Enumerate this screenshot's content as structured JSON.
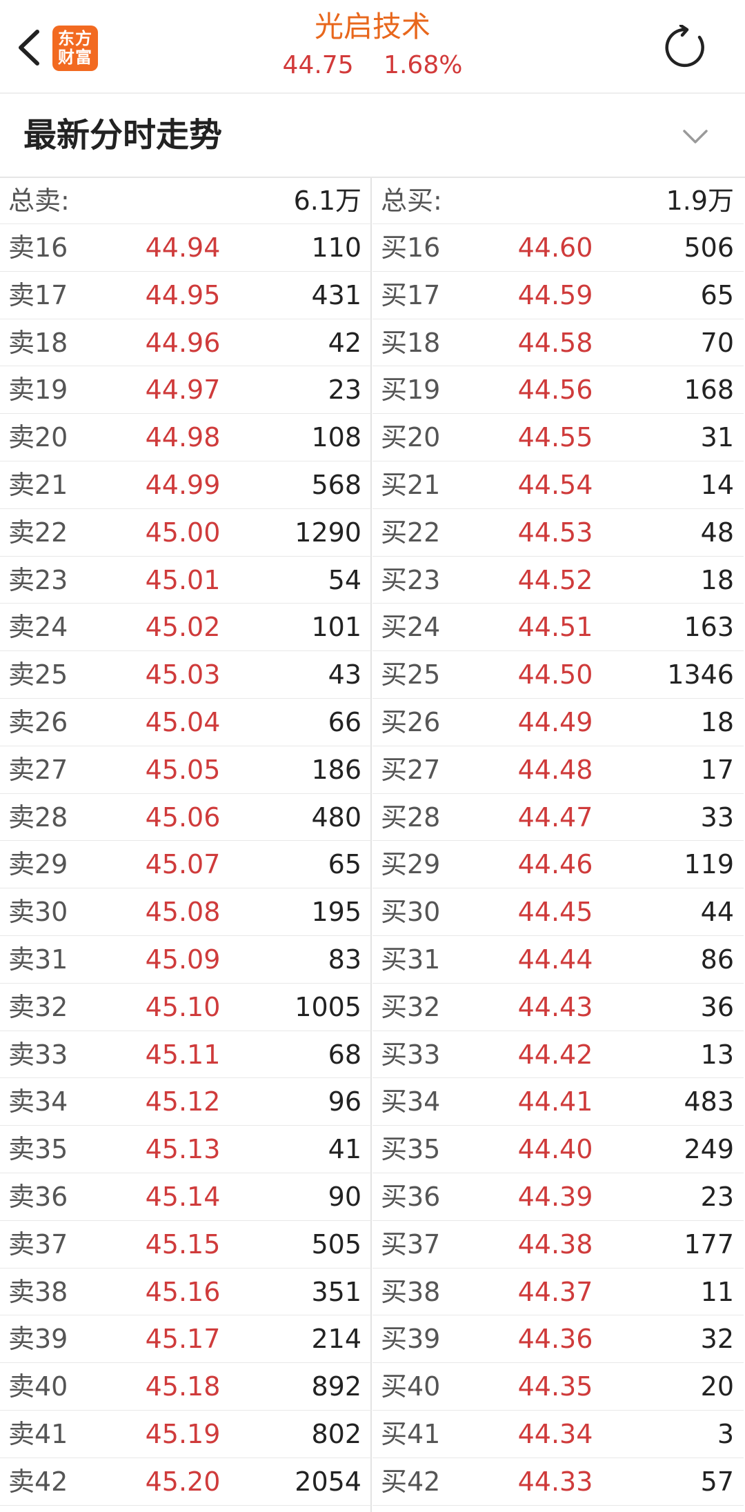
{
  "header": {
    "stock_name": "光启技术",
    "price": "44.75",
    "change_pct": "1.68%",
    "logo_line1": "东方",
    "logo_line2": "财富"
  },
  "section": {
    "title": "最新分时走势"
  },
  "colors": {
    "accent": "#e8671c",
    "price_red": "#cf3b3b",
    "logo_bg": "#f26a21"
  },
  "sell": {
    "total_label": "总卖:",
    "total_value": "6.1万",
    "rows": [
      {
        "label": "卖16",
        "price": "44.94",
        "volume": "110"
      },
      {
        "label": "卖17",
        "price": "44.95",
        "volume": "431"
      },
      {
        "label": "卖18",
        "price": "44.96",
        "volume": "42"
      },
      {
        "label": "卖19",
        "price": "44.97",
        "volume": "23"
      },
      {
        "label": "卖20",
        "price": "44.98",
        "volume": "108"
      },
      {
        "label": "卖21",
        "price": "44.99",
        "volume": "568"
      },
      {
        "label": "卖22",
        "price": "45.00",
        "volume": "1290"
      },
      {
        "label": "卖23",
        "price": "45.01",
        "volume": "54"
      },
      {
        "label": "卖24",
        "price": "45.02",
        "volume": "101"
      },
      {
        "label": "卖25",
        "price": "45.03",
        "volume": "43"
      },
      {
        "label": "卖26",
        "price": "45.04",
        "volume": "66"
      },
      {
        "label": "卖27",
        "price": "45.05",
        "volume": "186"
      },
      {
        "label": "卖28",
        "price": "45.06",
        "volume": "480"
      },
      {
        "label": "卖29",
        "price": "45.07",
        "volume": "65"
      },
      {
        "label": "卖30",
        "price": "45.08",
        "volume": "195"
      },
      {
        "label": "卖31",
        "price": "45.09",
        "volume": "83"
      },
      {
        "label": "卖32",
        "price": "45.10",
        "volume": "1005"
      },
      {
        "label": "卖33",
        "price": "45.11",
        "volume": "68"
      },
      {
        "label": "卖34",
        "price": "45.12",
        "volume": "96"
      },
      {
        "label": "卖35",
        "price": "45.13",
        "volume": "41"
      },
      {
        "label": "卖36",
        "price": "45.14",
        "volume": "90"
      },
      {
        "label": "卖37",
        "price": "45.15",
        "volume": "505"
      },
      {
        "label": "卖38",
        "price": "45.16",
        "volume": "351"
      },
      {
        "label": "卖39",
        "price": "45.17",
        "volume": "214"
      },
      {
        "label": "卖40",
        "price": "45.18",
        "volume": "892"
      },
      {
        "label": "卖41",
        "price": "45.19",
        "volume": "802"
      },
      {
        "label": "卖42",
        "price": "45.20",
        "volume": "2054"
      }
    ]
  },
  "buy": {
    "total_label": "总买:",
    "total_value": "1.9万",
    "rows": [
      {
        "label": "买16",
        "price": "44.60",
        "volume": "506"
      },
      {
        "label": "买17",
        "price": "44.59",
        "volume": "65"
      },
      {
        "label": "买18",
        "price": "44.58",
        "volume": "70"
      },
      {
        "label": "买19",
        "price": "44.56",
        "volume": "168"
      },
      {
        "label": "买20",
        "price": "44.55",
        "volume": "31"
      },
      {
        "label": "买21",
        "price": "44.54",
        "volume": "14"
      },
      {
        "label": "买22",
        "price": "44.53",
        "volume": "48"
      },
      {
        "label": "买23",
        "price": "44.52",
        "volume": "18"
      },
      {
        "label": "买24",
        "price": "44.51",
        "volume": "163"
      },
      {
        "label": "买25",
        "price": "44.50",
        "volume": "1346"
      },
      {
        "label": "买26",
        "price": "44.49",
        "volume": "18"
      },
      {
        "label": "买27",
        "price": "44.48",
        "volume": "17"
      },
      {
        "label": "买28",
        "price": "44.47",
        "volume": "33"
      },
      {
        "label": "买29",
        "price": "44.46",
        "volume": "119"
      },
      {
        "label": "买30",
        "price": "44.45",
        "volume": "44"
      },
      {
        "label": "买31",
        "price": "44.44",
        "volume": "86"
      },
      {
        "label": "买32",
        "price": "44.43",
        "volume": "36"
      },
      {
        "label": "买33",
        "price": "44.42",
        "volume": "13"
      },
      {
        "label": "买34",
        "price": "44.41",
        "volume": "483"
      },
      {
        "label": "买35",
        "price": "44.40",
        "volume": "249"
      },
      {
        "label": "买36",
        "price": "44.39",
        "volume": "23"
      },
      {
        "label": "买37",
        "price": "44.38",
        "volume": "177"
      },
      {
        "label": "买38",
        "price": "44.37",
        "volume": "11"
      },
      {
        "label": "买39",
        "price": "44.36",
        "volume": "32"
      },
      {
        "label": "买40",
        "price": "44.35",
        "volume": "20"
      },
      {
        "label": "买41",
        "price": "44.34",
        "volume": "3"
      },
      {
        "label": "买42",
        "price": "44.33",
        "volume": "57"
      }
    ]
  }
}
